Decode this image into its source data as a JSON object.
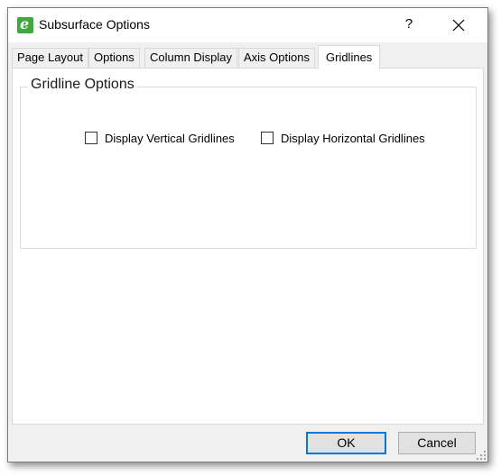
{
  "window": {
    "title": "Subsurface Options",
    "help_label": "?"
  },
  "tabs": [
    {
      "label": "Page Layout",
      "active": false
    },
    {
      "label": "Options",
      "active": false
    },
    {
      "label": "Column Display",
      "active": false
    },
    {
      "label": "Axis Options",
      "active": false
    },
    {
      "label": "Gridlines",
      "active": true
    }
  ],
  "gridline_options": {
    "group_label": "Gridline Options",
    "vertical": {
      "label": "Display Vertical Gridlines",
      "checked": false
    },
    "horizontal": {
      "label": "Display Horizontal Gridlines",
      "checked": false
    }
  },
  "buttons": {
    "ok": "OK",
    "cancel": "Cancel"
  },
  "icons": {
    "app": "app-icon",
    "close": "close-icon",
    "help": "help-icon"
  },
  "colors": {
    "app_icon": "#3fa83f",
    "default_button_border": "#0078d7"
  }
}
